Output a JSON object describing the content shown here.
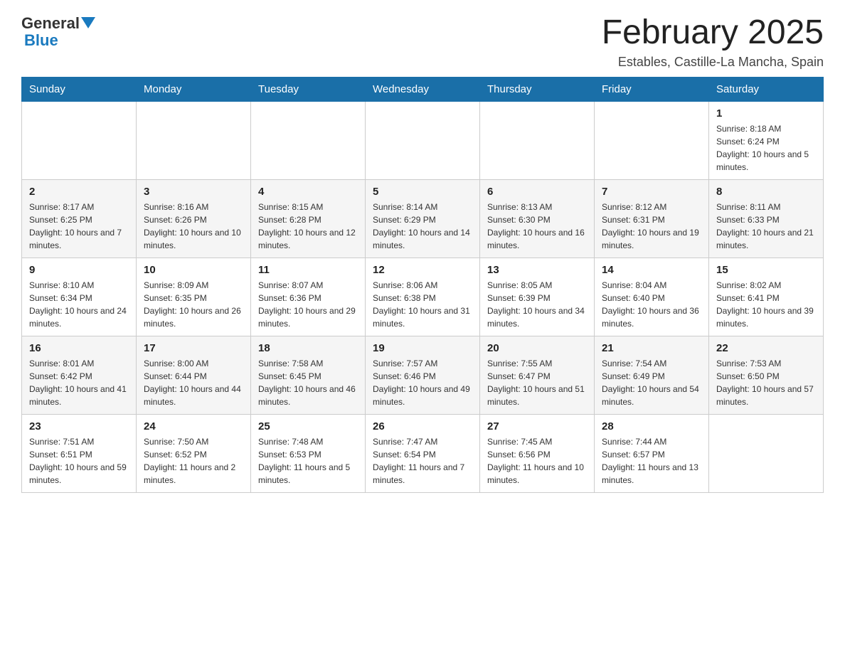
{
  "header": {
    "logo_general": "General",
    "logo_blue": "Blue",
    "month_title": "February 2025",
    "location": "Estables, Castille-La Mancha, Spain"
  },
  "days_of_week": [
    "Sunday",
    "Monday",
    "Tuesday",
    "Wednesday",
    "Thursday",
    "Friday",
    "Saturday"
  ],
  "weeks": [
    [
      {
        "day": "",
        "info": ""
      },
      {
        "day": "",
        "info": ""
      },
      {
        "day": "",
        "info": ""
      },
      {
        "day": "",
        "info": ""
      },
      {
        "day": "",
        "info": ""
      },
      {
        "day": "",
        "info": ""
      },
      {
        "day": "1",
        "info": "Sunrise: 8:18 AM\nSunset: 6:24 PM\nDaylight: 10 hours and 5 minutes."
      }
    ],
    [
      {
        "day": "2",
        "info": "Sunrise: 8:17 AM\nSunset: 6:25 PM\nDaylight: 10 hours and 7 minutes."
      },
      {
        "day": "3",
        "info": "Sunrise: 8:16 AM\nSunset: 6:26 PM\nDaylight: 10 hours and 10 minutes."
      },
      {
        "day": "4",
        "info": "Sunrise: 8:15 AM\nSunset: 6:28 PM\nDaylight: 10 hours and 12 minutes."
      },
      {
        "day": "5",
        "info": "Sunrise: 8:14 AM\nSunset: 6:29 PM\nDaylight: 10 hours and 14 minutes."
      },
      {
        "day": "6",
        "info": "Sunrise: 8:13 AM\nSunset: 6:30 PM\nDaylight: 10 hours and 16 minutes."
      },
      {
        "day": "7",
        "info": "Sunrise: 8:12 AM\nSunset: 6:31 PM\nDaylight: 10 hours and 19 minutes."
      },
      {
        "day": "8",
        "info": "Sunrise: 8:11 AM\nSunset: 6:33 PM\nDaylight: 10 hours and 21 minutes."
      }
    ],
    [
      {
        "day": "9",
        "info": "Sunrise: 8:10 AM\nSunset: 6:34 PM\nDaylight: 10 hours and 24 minutes."
      },
      {
        "day": "10",
        "info": "Sunrise: 8:09 AM\nSunset: 6:35 PM\nDaylight: 10 hours and 26 minutes."
      },
      {
        "day": "11",
        "info": "Sunrise: 8:07 AM\nSunset: 6:36 PM\nDaylight: 10 hours and 29 minutes."
      },
      {
        "day": "12",
        "info": "Sunrise: 8:06 AM\nSunset: 6:38 PM\nDaylight: 10 hours and 31 minutes."
      },
      {
        "day": "13",
        "info": "Sunrise: 8:05 AM\nSunset: 6:39 PM\nDaylight: 10 hours and 34 minutes."
      },
      {
        "day": "14",
        "info": "Sunrise: 8:04 AM\nSunset: 6:40 PM\nDaylight: 10 hours and 36 minutes."
      },
      {
        "day": "15",
        "info": "Sunrise: 8:02 AM\nSunset: 6:41 PM\nDaylight: 10 hours and 39 minutes."
      }
    ],
    [
      {
        "day": "16",
        "info": "Sunrise: 8:01 AM\nSunset: 6:42 PM\nDaylight: 10 hours and 41 minutes."
      },
      {
        "day": "17",
        "info": "Sunrise: 8:00 AM\nSunset: 6:44 PM\nDaylight: 10 hours and 44 minutes."
      },
      {
        "day": "18",
        "info": "Sunrise: 7:58 AM\nSunset: 6:45 PM\nDaylight: 10 hours and 46 minutes."
      },
      {
        "day": "19",
        "info": "Sunrise: 7:57 AM\nSunset: 6:46 PM\nDaylight: 10 hours and 49 minutes."
      },
      {
        "day": "20",
        "info": "Sunrise: 7:55 AM\nSunset: 6:47 PM\nDaylight: 10 hours and 51 minutes."
      },
      {
        "day": "21",
        "info": "Sunrise: 7:54 AM\nSunset: 6:49 PM\nDaylight: 10 hours and 54 minutes."
      },
      {
        "day": "22",
        "info": "Sunrise: 7:53 AM\nSunset: 6:50 PM\nDaylight: 10 hours and 57 minutes."
      }
    ],
    [
      {
        "day": "23",
        "info": "Sunrise: 7:51 AM\nSunset: 6:51 PM\nDaylight: 10 hours and 59 minutes."
      },
      {
        "day": "24",
        "info": "Sunrise: 7:50 AM\nSunset: 6:52 PM\nDaylight: 11 hours and 2 minutes."
      },
      {
        "day": "25",
        "info": "Sunrise: 7:48 AM\nSunset: 6:53 PM\nDaylight: 11 hours and 5 minutes."
      },
      {
        "day": "26",
        "info": "Sunrise: 7:47 AM\nSunset: 6:54 PM\nDaylight: 11 hours and 7 minutes."
      },
      {
        "day": "27",
        "info": "Sunrise: 7:45 AM\nSunset: 6:56 PM\nDaylight: 11 hours and 10 minutes."
      },
      {
        "day": "28",
        "info": "Sunrise: 7:44 AM\nSunset: 6:57 PM\nDaylight: 11 hours and 13 minutes."
      },
      {
        "day": "",
        "info": ""
      }
    ]
  ]
}
